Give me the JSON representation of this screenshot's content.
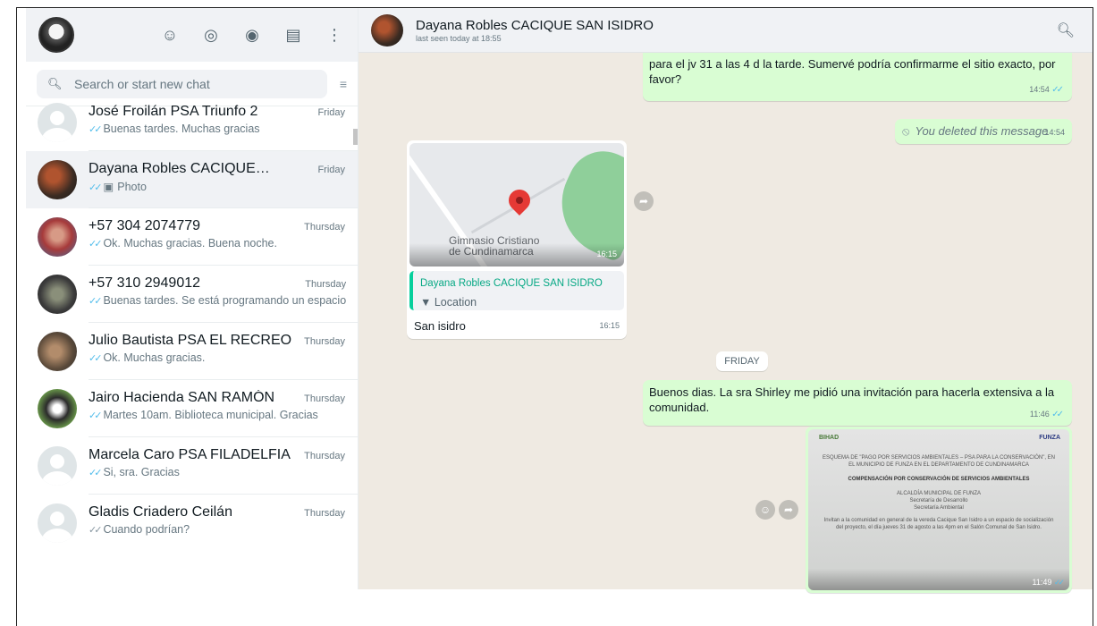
{
  "left": {
    "search_placeholder": "Search or start new chat",
    "chats": [
      {
        "name": "José Froilán PSA Triunfo 2",
        "time": "Friday",
        "last": "Buenas tardes. Muchas gracias"
      },
      {
        "name": "Dayana Robles CACIQUE SAN ISIDRO",
        "time": "Friday",
        "last": "Photo"
      },
      {
        "name": "+57 304 2074779",
        "time": "Thursday",
        "last": "Ok. Muchas gracias. Buena noche."
      },
      {
        "name": "+57 310 2949012",
        "time": "Thursday",
        "last": "Buenas tardes. Se está programando un espacio"
      },
      {
        "name": "Julio Bautista PSA EL RECREO",
        "time": "Thursday",
        "last": "Ok. Muchas gracias."
      },
      {
        "name": "Jairo Hacienda SAN RAMÓN",
        "time": "Thursday",
        "last": "Martes 10am. Biblioteca municipal. Gracias"
      },
      {
        "name": "Marcela Caro PSA FILADELFIA",
        "time": "Thursday",
        "last": "Si, sra. Gracias"
      },
      {
        "name": "Gladis Criadero Ceilán",
        "time": "Thursday",
        "last": "Cuando podrían?"
      }
    ]
  },
  "right": {
    "contact_name": "Dayana Robles CACIQUE SAN ISIDRO",
    "contact_status": "last seen today at 18:55",
    "messages": {
      "m1_text": "para el jv 31 a las 4 d la tarde. Sumervé podría confirmarme el sitio exacto, por favor?",
      "m1_time": "14:54",
      "m2_text": "You deleted this message",
      "m2_time": "14:54",
      "map_label": "Gimnasio Cristiano de Cundinamarca",
      "map_time": "16:15",
      "loc_sender": "Dayana Robles CACIQUE SAN ISIDRO",
      "loc_sub": "Location",
      "loc_caption": "San isidro",
      "loc_time": "16:15",
      "day_divider": "FRIDAY",
      "m3_text": "Buenos dias. La sra Shirley me pidió una invitación para hacerla extensiva a la comunidad.",
      "m3_time": "11:46",
      "img_time": "11:49",
      "doc": {
        "logo_left": "BIHAD",
        "logo_right": "FUNZA",
        "title": "ESQUEMA DE \"PAGO POR SERVICIOS AMBIENTALES – PSA PARA LA CONSERVACIÓN\", EN EL MUNICIPIO DE FUNZA EN EL DEPARTAMENTO DE CUNDINAMARCA",
        "heading": "COMPENSACIÓN POR CONSERVACIÓN DE SERVICIOS AMBIENTALES",
        "org1": "ALCALDÍA MUNICIPAL DE FUNZA",
        "org2": "Secretaría de Desarrollo",
        "org3": "Secretaría Ambiental",
        "body": "Invitan a la comunidad en general de la vereda Cacique San Isidro a un espacio de socialización del proyecto, el día jueves 31 de agosto a las 4pm en el Salón Comunal de San Isidro."
      }
    }
  }
}
